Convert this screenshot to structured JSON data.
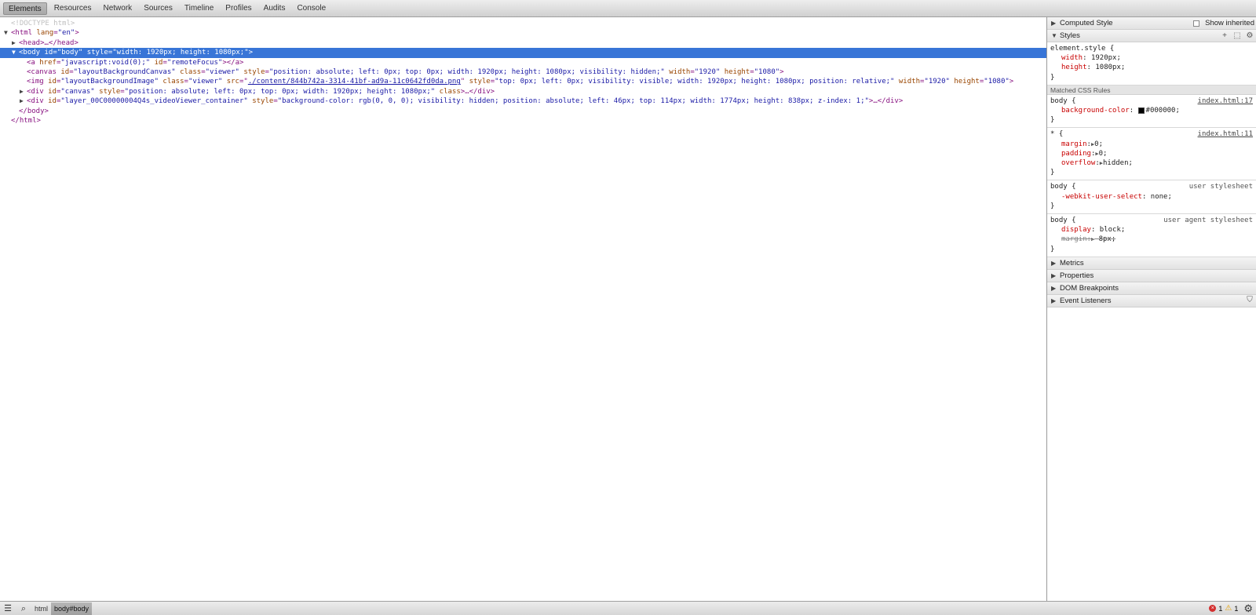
{
  "toolbar": {
    "tabs": [
      {
        "label": "Elements",
        "active": true
      },
      {
        "label": "Resources"
      },
      {
        "label": "Network"
      },
      {
        "label": "Sources"
      },
      {
        "label": "Timeline"
      },
      {
        "label": "Profiles"
      },
      {
        "label": "Audits"
      },
      {
        "label": "Console"
      }
    ]
  },
  "tree": {
    "doctype": "<!DOCTYPE html>",
    "html_open": "<html",
    "html_lang_name": "lang",
    "html_lang_val": "\"en\"",
    "head": "<head>…</head>",
    "body_open": "<body",
    "body_id_name": "id",
    "body_id_val": "\"body\"",
    "body_style_name": "style",
    "body_style_val": "\"width: 1920px; height: 1080px;\"",
    "a_tag": "<a",
    "a_href_name": "href",
    "a_href_val": "\"javascript:void(0);\"",
    "a_id_name": "id",
    "a_id_val": "\"remoteFocus\"",
    "a_close": "></a>",
    "canvas_tag": "<canvas",
    "canvas_id_name": "id",
    "canvas_id_val": "\"layoutBackgroundCanvas\"",
    "canvas_class_name": "class",
    "canvas_class_val": "\"viewer\"",
    "canvas_style_name": "style",
    "canvas_style_val": "\"position: absolute; left: 0px; top: 0px; width: 1920px; height: 1080px; visibility: hidden;\"",
    "canvas_w_name": "width",
    "canvas_w_val": "\"1920\"",
    "canvas_h_name": "height",
    "canvas_h_val": "\"1080\"",
    "img_tag": "<img",
    "img_id_name": "id",
    "img_id_val": "\"layoutBackgroundImage\"",
    "img_class_name": "class",
    "img_class_val": "\"viewer\"",
    "img_src_name": "src",
    "img_src_val": "./content/844b742a-3314-41bf-ad9a-11c0642fd0da.png",
    "img_style_name": "style",
    "img_style_val": "\"top: 0px; left: 0px; visibility: visible; width: 1920px; height: 1080px; position: relative;\"",
    "img_w_name": "width",
    "img_w_val": "\"1920\"",
    "img_h_name": "height",
    "img_h_val": "\"1080\"",
    "div1_tag": "<div",
    "div1_id_name": "id",
    "div1_id_val": "\"canvas\"",
    "div1_style_name": "style",
    "div1_style_val": "\"position: absolute; left: 0px; top: 0px; width: 1920px; height: 1080px;\"",
    "div1_class_name": "class",
    "div1_close": ">…</div>",
    "div2_tag": "<div",
    "div2_id_name": "id",
    "div2_id_val": "\"layer_00C00000004Q4s_videoViewer_container\"",
    "div2_style_name": "style",
    "div2_style_val": "\"background-color: rgb(0, 0, 0); visibility: hidden; position: absolute; left: 46px; top: 114px; width: 1774px; height: 838px; z-index: 1;\"",
    "div2_close": ">…</div>",
    "body_close": "</body>",
    "html_close": "</html>"
  },
  "sidebar": {
    "computed_style": "Computed Style",
    "show_inherited": "Show inherited",
    "styles": "Styles",
    "element_style": {
      "selector": "element.style {",
      "props": [
        {
          "name": "width",
          "value": "1920px;"
        },
        {
          "name": "height",
          "value": "1080px;"
        }
      ],
      "close": "}"
    },
    "matched_header": "Matched CSS Rules",
    "rule1": {
      "selector": "body {",
      "source": "index.html:17",
      "prop_name": "background-color",
      "prop_val": "#000000;",
      "swatch_color": "#000000",
      "close": "}"
    },
    "rule2": {
      "selector": "* {",
      "source": "index.html:11",
      "props": [
        {
          "name": "margin",
          "value": "0;"
        },
        {
          "name": "padding",
          "value": "0;"
        },
        {
          "name": "overflow",
          "value": "hidden;"
        }
      ],
      "close": "}"
    },
    "rule3": {
      "selector": "body {",
      "source": "user stylesheet",
      "prop_name": "-webkit-user-select",
      "prop_val": "none;",
      "close": "}"
    },
    "rule4": {
      "selector": "body {",
      "source": "user agent stylesheet",
      "props": [
        {
          "name": "display",
          "value": "block;"
        },
        {
          "name": "margin",
          "value": "8px;"
        }
      ],
      "close": "}"
    },
    "metrics": "Metrics",
    "properties": "Properties",
    "dom_breakpoints": "DOM Breakpoints",
    "event_listeners": "Event Listeners"
  },
  "status": {
    "crumb_html": "html",
    "crumb_body": "body#body",
    "errors": "1",
    "warnings": "1"
  }
}
